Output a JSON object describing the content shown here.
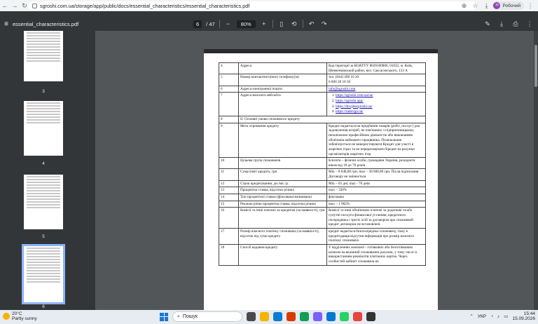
{
  "browser": {
    "url": "sgroshi.com.ua/storage/app/public/docs/essential_characteristics/essential_characteristics.pdf",
    "profile_initial": "Н",
    "profile_name": "Робочий"
  },
  "pdf_toolbar": {
    "file_name": "essential_characteristics.pdf",
    "current_page": "6",
    "total_pages": "/ 47",
    "zoom": "80%"
  },
  "thumbnails": [
    {
      "label": "3"
    },
    {
      "label": "4"
    },
    {
      "label": "5"
    },
    {
      "label": "6"
    }
  ],
  "table": {
    "rows": [
      {
        "n": "4",
        "k": "Адреса",
        "v": "Код території за КОАТУУ 8039100000, 01032, м. Київ, Шевченківський район, вул. Саксаганського, 133 А"
      },
      {
        "n": "5",
        "k": "Номер контактного(них) телефону(ів)",
        "v": "тел. (044) 498 10 20\n0 800 20 10 50"
      },
      {
        "n": "6",
        "k": "Адреса електронної пошти",
        "link": "info@sgroshi.com"
      },
      {
        "n": "7",
        "k": "Адреса власного вебсайта",
        "links": [
          "https://sgroshi.com.ua/ua/",
          "https://sgroshi.app/",
          "https://dovgbezgroshi.ua/",
          "https://zadovgo.ua/"
        ]
      },
      {
        "n": "8",
        "k": "II. Основні умови споживчого кредиту",
        "v": ""
      },
      {
        "n": "9",
        "k": "Мета отримання кредиту",
        "v": "Кредит надається на придбання товарів (робіт, послуг) для задоволення потреб, не пов'язаних з підприємницькою, незалежною професійною діяльністю або виконанням обов'язків найманого працівника. Позичальник зобов'язується не використовувати Кредит для участі в азартних іграх та не перераховувати Кредит на рахунки організаторів азартних ігор."
      },
      {
        "n": "10",
        "k": "Цільова група споживачів",
        "v": "Клієнти – фізичні особи, громадяни України, резиденти віком від 18 до 70 років"
      },
      {
        "n": "11",
        "k": "Сума/ліміт кредиту, грн",
        "v": "Min – 8 648,00 грн, max – 30 000,00 грн. Після підписання Договору не змінюється"
      },
      {
        "n": "12",
        "k": "Строк кредитування, дн./міс./р.",
        "v": "Min – 63 дні, max - 70 днів"
      },
      {
        "n": "13",
        "k": "Процентна ставка, відсотки річних",
        "v": "max – 330%"
      },
      {
        "n": "14",
        "k": "Тип процентної ставки (фіксована/змінювана)",
        "v": "фіксована"
      },
      {
        "n": "15",
        "k": "Реальна річна процентна ставка, відсотки річних",
        "v": "max – 1 982%"
      },
      {
        "n": "16",
        "k": "Комісії та інші платежі за кредитом (за наявності), грн",
        "v": "Комісії та інші обов'язкові платежі за додаткові та/або супутні послуги фінансової установи, кредитного посередника і третіх осіб за договором про споживчий кредит договором не встановлені."
      },
      {
        "n": "17",
        "k": "Розмір власного платежу споживача (за наявності), відсоток від суми кредиту",
        "v": "кредит надається безпосередньо споживачу, тому в кредитодавця відсутня інформація про розмір власного платежу споживача"
      },
      {
        "n": "18",
        "k": "Спосіб надання кредиту",
        "v": "У відділеннях компанії - готівкових або безготівковим шляхом на вказаний споживачем рахунок, у тому числі із використанням реквізитів платіжних карток. Через особистий кабінет споживача на"
      }
    ]
  },
  "taskbar": {
    "temperature": "20°C",
    "weather": "Partly sunny",
    "search_placeholder": "Пошук",
    "language": "УКР",
    "time": "15:44",
    "date": "15.09.2026"
  }
}
